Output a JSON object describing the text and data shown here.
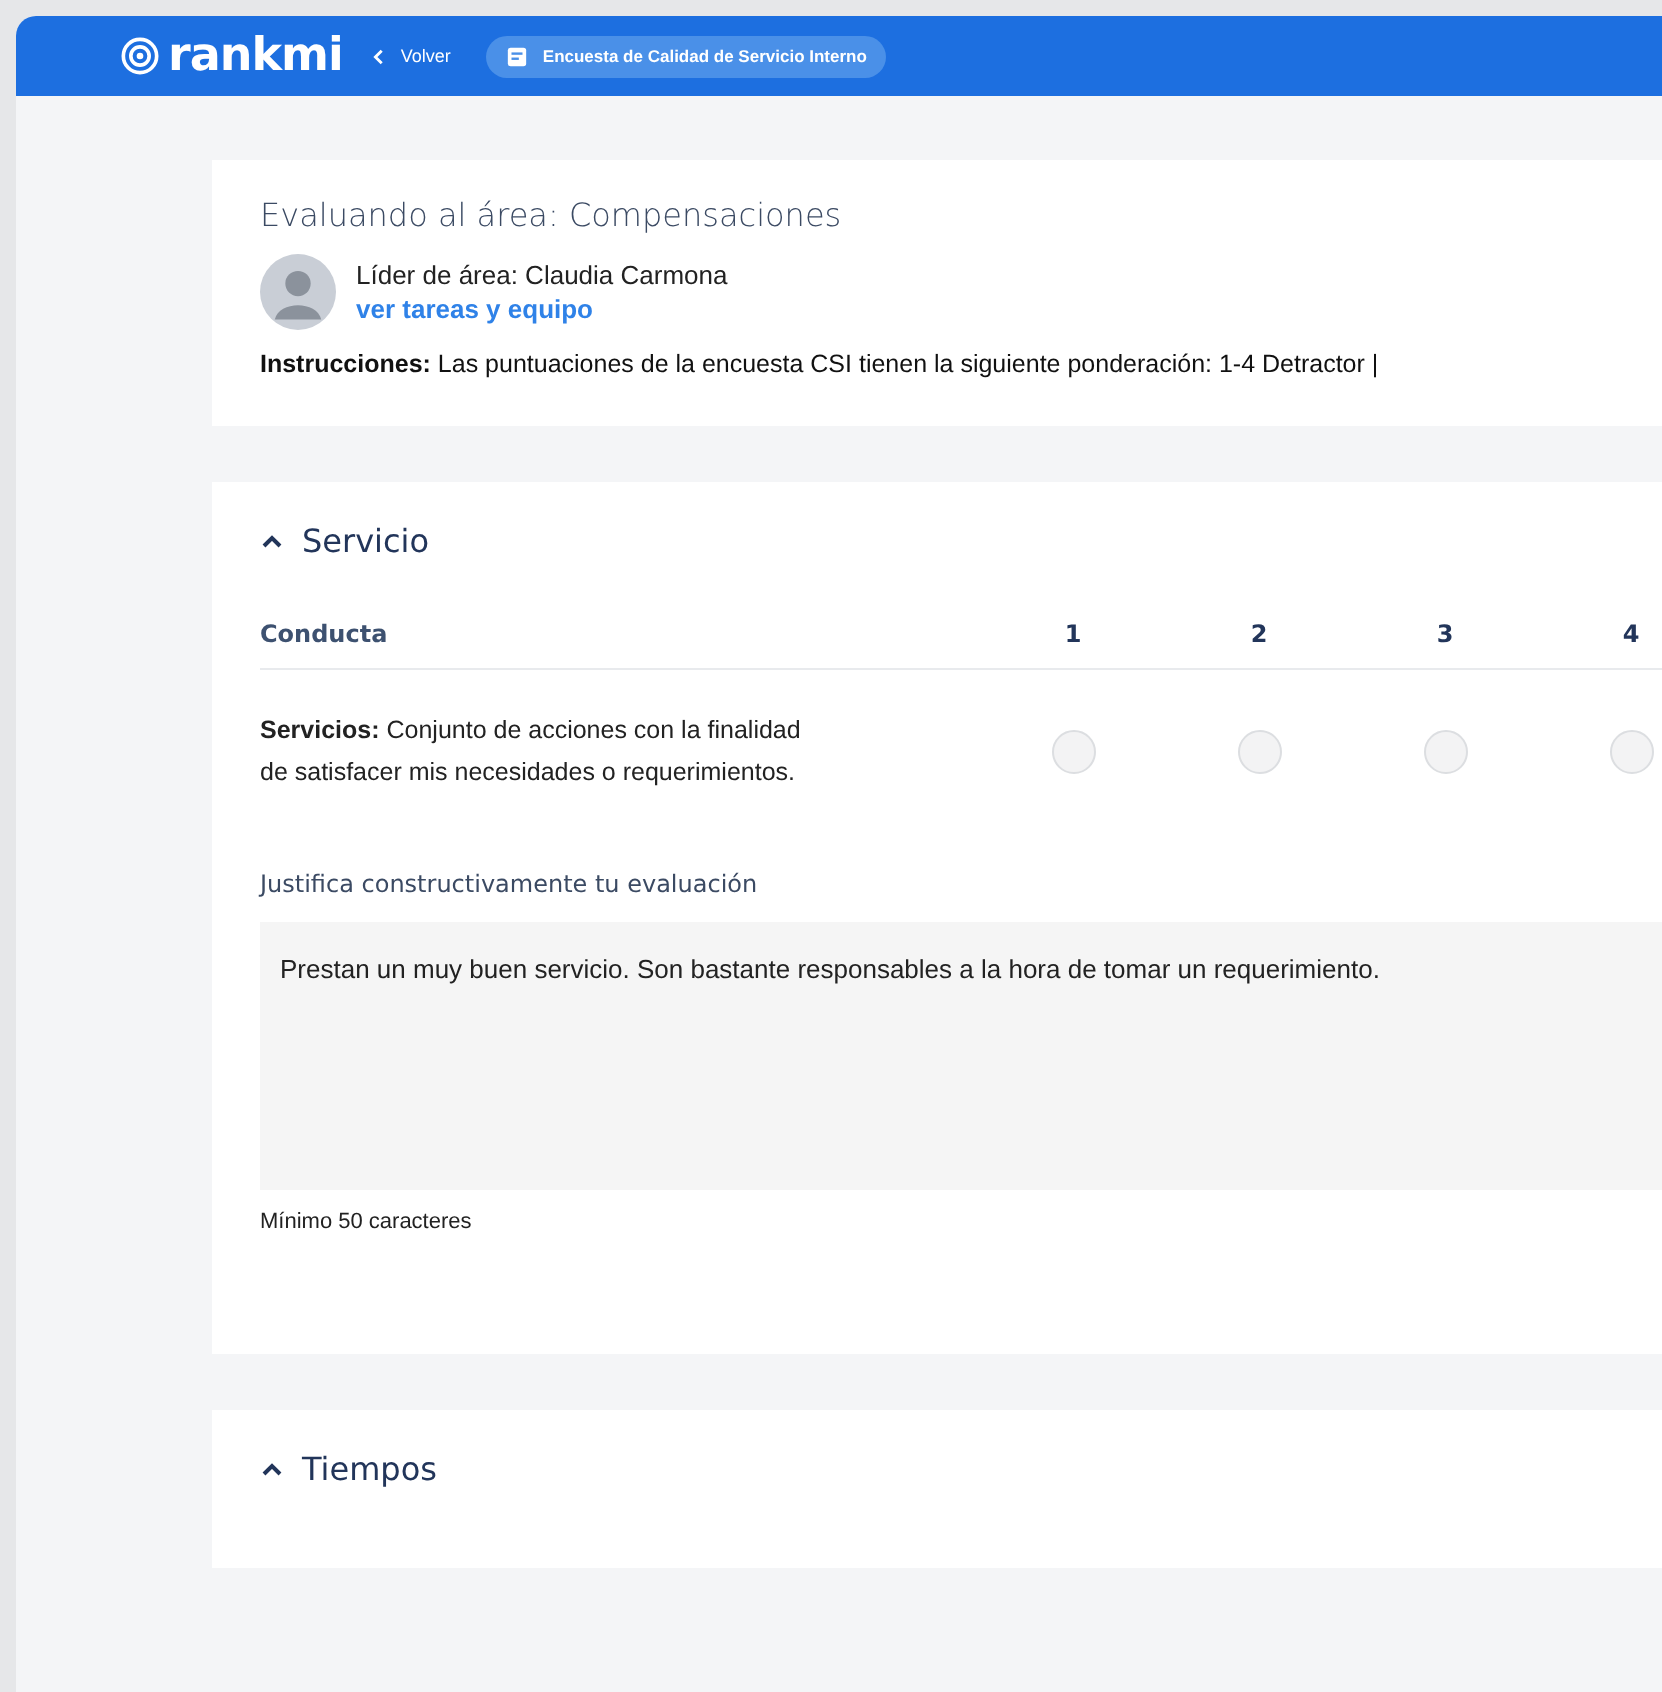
{
  "nav": {
    "brand": "rankmi",
    "back": "Volver",
    "survey_chip": "Encuesta de Calidad de Servicio Interno"
  },
  "header": {
    "title": "Evaluando al área: Compensaciones",
    "leader": "Líder de área: Claudia Carmona",
    "link": "ver tareas y equipo",
    "instructions": "**Instrucciones:** Las puntuaciones de la encuesta CSI tienen la siguiente ponderación: 1-4 Detractor |"
  },
  "sections": [
    {
      "title": "Servicio",
      "expanded": true,
      "columns": [
        "Conducta",
        "1",
        "2",
        "3",
        "4"
      ],
      "rows": [
        {
          "text": "**Servicios:** Conjunto de acciones con la finalidad de satisfacer mis necesidades o requerimientos.",
          "options": [
            {
              "selected": false
            },
            {
              "selected": false
            },
            {
              "selected": false
            },
            {
              "selected": false
            }
          ]
        }
      ],
      "justification": {
        "label": "Justifica constructivamente tu evaluación",
        "value": "Prestan un muy buen servicio. Son bastante responsables a la hora de tomar un requerimiento.",
        "hint": "Mínimo 50 caracteres"
      }
    },
    {
      "title": "Tiempos",
      "expanded": true
    }
  ]
}
